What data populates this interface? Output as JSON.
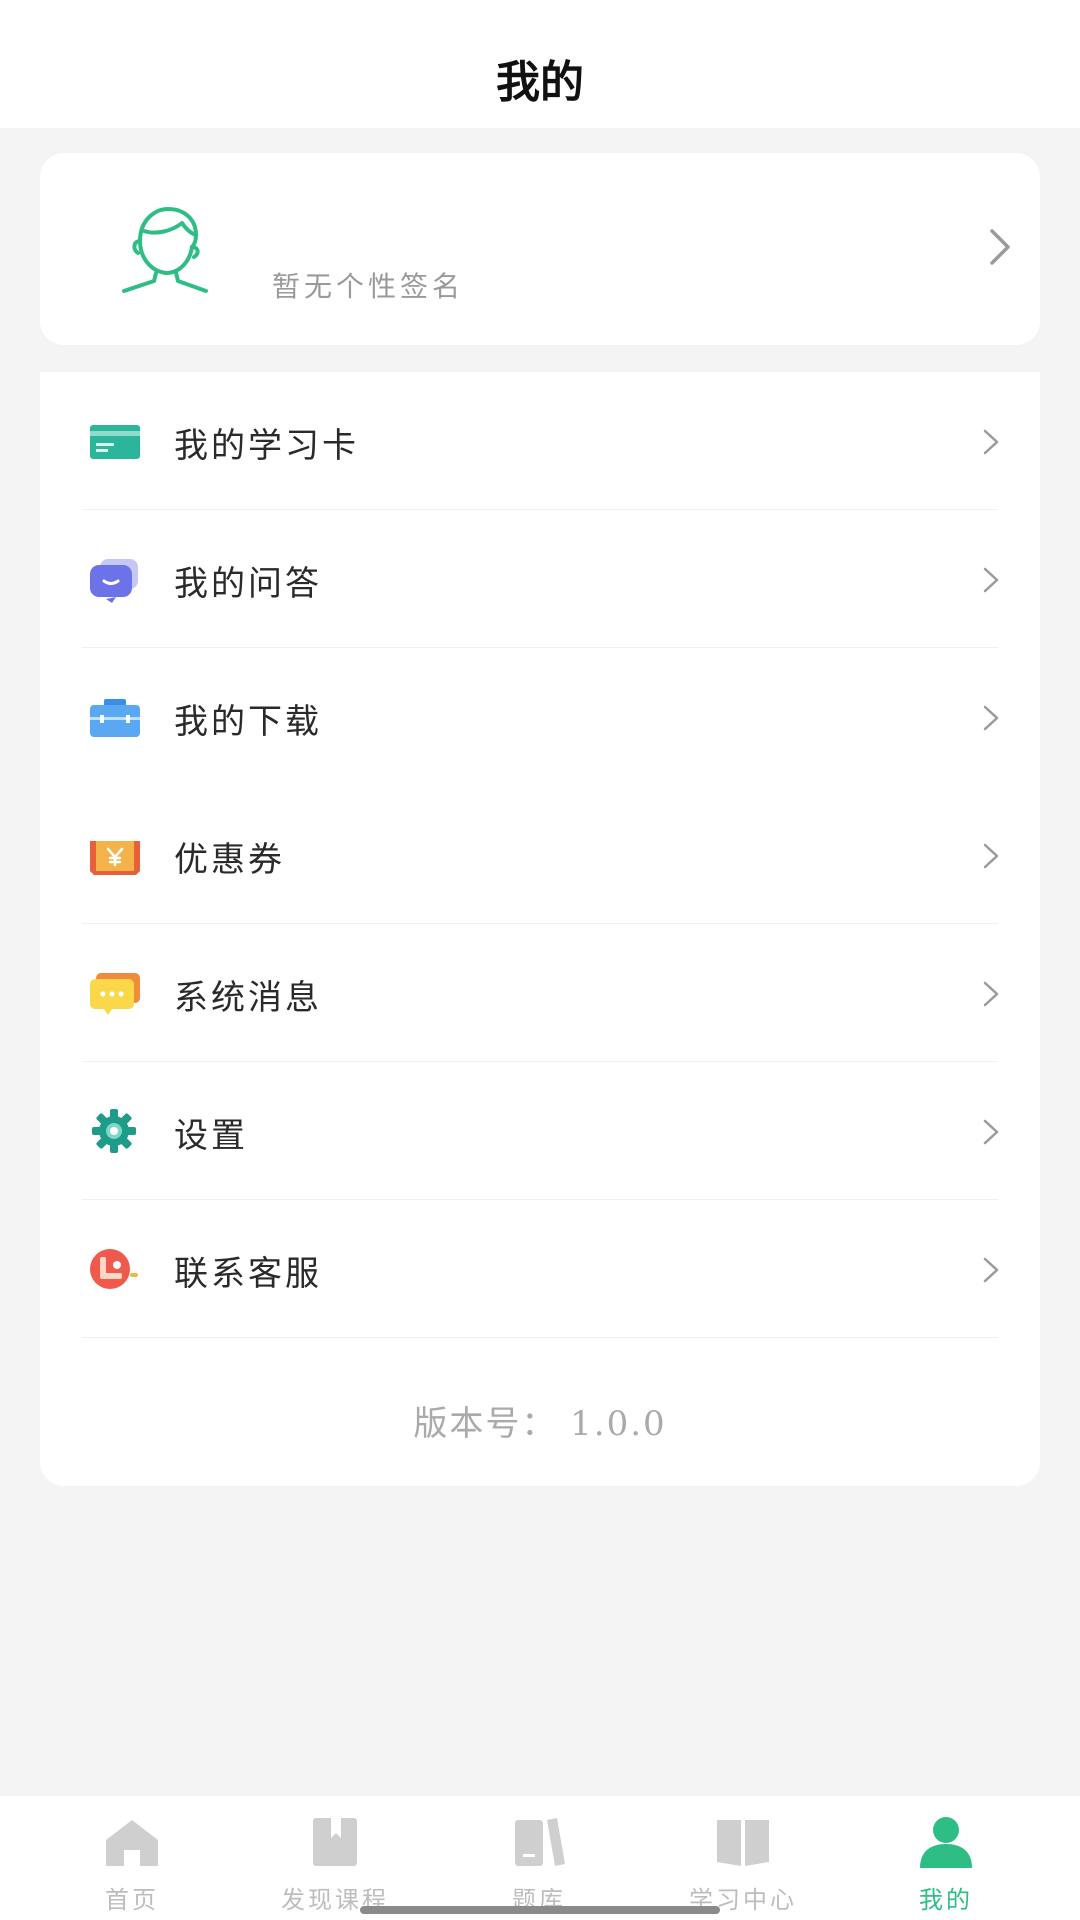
{
  "header": {
    "title": "我的"
  },
  "profile": {
    "signature": "暂无个性签名",
    "avatar_icon": "user-avatar-icon",
    "accent": "#2ebd85"
  },
  "menu": {
    "items": [
      {
        "label": "我的学习卡",
        "icon": "study-card-icon"
      },
      {
        "label": "我的问答",
        "icon": "chat-bubble-icon"
      },
      {
        "label": "我的下载",
        "icon": "briefcase-icon"
      },
      {
        "label": "优惠券",
        "icon": "coupon-icon"
      },
      {
        "label": "系统消息",
        "icon": "message-icon"
      },
      {
        "label": "设置",
        "icon": "gear-icon"
      },
      {
        "label": "联系客服",
        "icon": "customer-service-icon"
      }
    ],
    "version": "版本号： 1.0.0"
  },
  "tabbar": {
    "tabs": [
      {
        "label": "首页",
        "icon": "home-icon",
        "active": false
      },
      {
        "label": "发现课程",
        "icon": "bookmark-book-icon",
        "active": false
      },
      {
        "label": "题库",
        "icon": "books-icon",
        "active": false
      },
      {
        "label": "学习中心",
        "icon": "open-book-icon",
        "active": false
      },
      {
        "label": "我的",
        "icon": "person-icon",
        "active": true
      }
    ],
    "active_color": "#2ebd85",
    "inactive_color": "#bdbdbd"
  }
}
